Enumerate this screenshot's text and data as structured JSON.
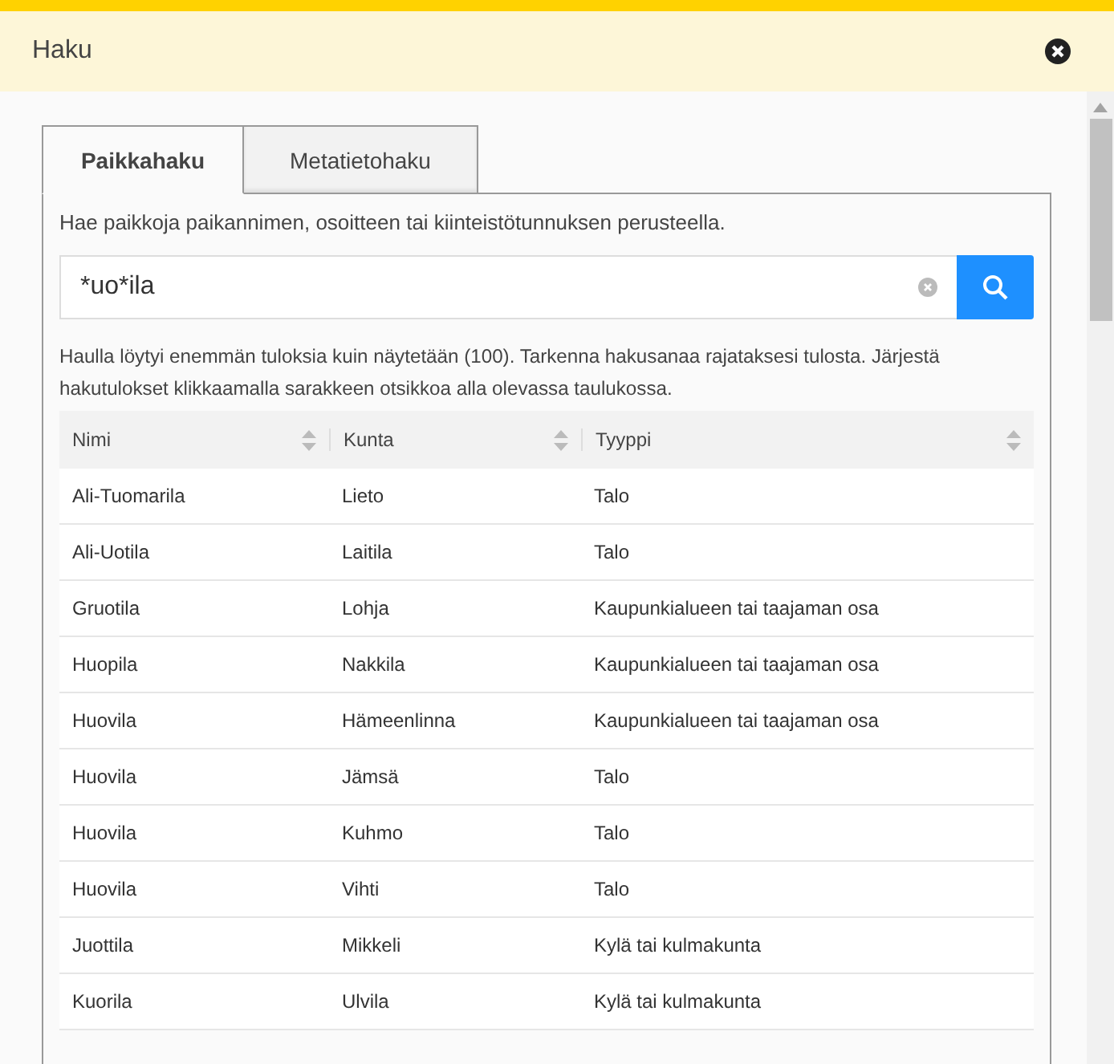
{
  "window": {
    "title": "Haku"
  },
  "tabs": [
    {
      "label": "Paikkahaku",
      "selected": true
    },
    {
      "label": "Metatietohaku",
      "selected": false
    }
  ],
  "intro": "Hae paikkoja paikannimen, osoitteen tai kiinteistötunnuksen perusteella.",
  "search": {
    "value": "*uo*ila"
  },
  "notice": "Haulla löytyi enemmän tuloksia kuin näytetään (100). Tarkenna hakusanaa rajataksesi tulosta. Järjestä hakutulokset klikkaamalla sarakkeen otsikkoa alla olevassa taulukossa.",
  "table": {
    "columns": [
      "Nimi",
      "Kunta",
      "Tyyppi"
    ],
    "rows": [
      [
        "Ali-Tuomarila",
        "Lieto",
        "Talo"
      ],
      [
        "Ali-Uotila",
        "Laitila",
        "Talo"
      ],
      [
        "Gruotila",
        "Lohja",
        "Kaupunkialueen tai taajaman osa"
      ],
      [
        "Huopila",
        "Nakkila",
        "Kaupunkialueen tai taajaman osa"
      ],
      [
        "Huovila",
        "Hämeenlinna",
        "Kaupunkialueen tai taajaman osa"
      ],
      [
        "Huovila",
        "Jämsä",
        "Talo"
      ],
      [
        "Huovila",
        "Kuhmo",
        "Talo"
      ],
      [
        "Huovila",
        "Vihti",
        "Talo"
      ],
      [
        "Juottila",
        "Mikkeli",
        "Kylä tai kulmakunta"
      ],
      [
        "Kuorila",
        "Ulvila",
        "Kylä tai kulmakunta"
      ]
    ]
  }
}
